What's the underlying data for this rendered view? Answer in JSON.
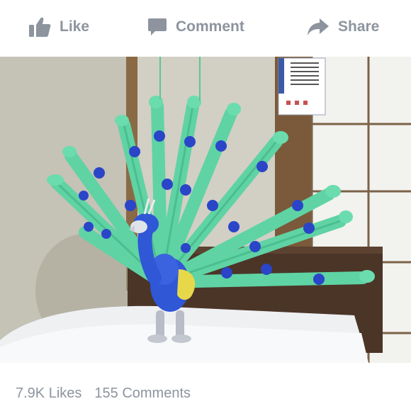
{
  "actions": {
    "like": {
      "label": "Like",
      "icon": "thumbs-up-icon"
    },
    "comment": {
      "label": "Comment",
      "icon": "speech-bubble-icon"
    },
    "share": {
      "label": "Share",
      "icon": "share-arrow-icon"
    }
  },
  "photo": {
    "subject": "balloon-peacock-photo"
  },
  "stats": {
    "likes": "7.9K Likes",
    "comments": "155 Comments"
  },
  "colors": {
    "icon_gray": "#8d949e",
    "text_gray": "#8d949e",
    "balloon_green": "#5fd3a4",
    "balloon_blue": "#2a45c8",
    "balloon_yellow": "#e7d84a"
  }
}
